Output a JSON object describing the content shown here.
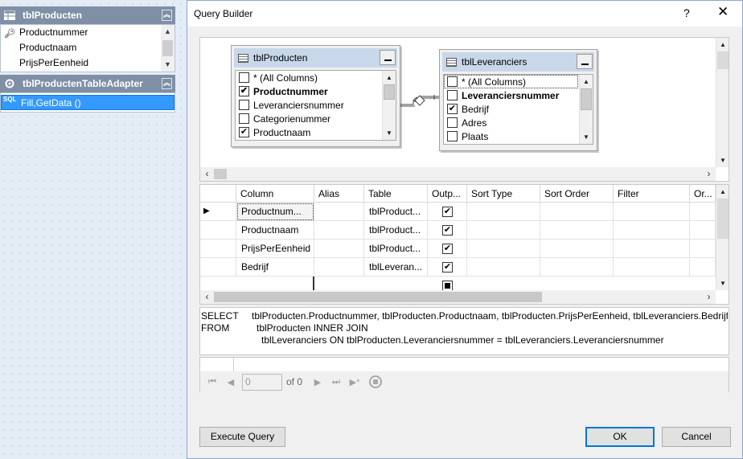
{
  "designer": {
    "table": {
      "title": "tblProducten",
      "collapse_icon": "double-chevron-up-icon",
      "rows": [
        "Productnummer",
        "Productnaam",
        "PrijsPerEenheid"
      ]
    },
    "adapter": {
      "title": "tblProductenTableAdapter",
      "collapse_icon": "double-chevron-up-icon",
      "method_icon_text": "SQL",
      "method": "Fill,GetData ()"
    }
  },
  "dialog": {
    "title": "Query Builder",
    "help": "?",
    "close": "✕"
  },
  "diagram": {
    "tables": [
      {
        "title": "tblProducten",
        "columns": [
          {
            "label": "* (All Columns)",
            "checked": false,
            "bold": false
          },
          {
            "label": "Productnummer",
            "checked": true,
            "bold": true
          },
          {
            "label": "Leveranciersnummer",
            "checked": false,
            "bold": false
          },
          {
            "label": "Categorienummer",
            "checked": false,
            "bold": false
          },
          {
            "label": "Productnaam",
            "checked": true,
            "bold": false
          }
        ]
      },
      {
        "title": "tblLeveranciers",
        "columns": [
          {
            "label": "* (All Columns)",
            "checked": false,
            "bold": false
          },
          {
            "label": "Leveranciersnummer",
            "checked": false,
            "bold": true
          },
          {
            "label": "Bedrijf",
            "checked": true,
            "bold": false
          },
          {
            "label": "Adres",
            "checked": false,
            "bold": false
          },
          {
            "label": "Plaats",
            "checked": false,
            "bold": false
          }
        ]
      }
    ]
  },
  "grid": {
    "headers": [
      "Column",
      "Alias",
      "Table",
      "Outp...",
      "Sort Type",
      "Sort Order",
      "Filter",
      "Or..."
    ],
    "rows": [
      {
        "column": "Productnum...",
        "alias": "",
        "table": "tblProduct...",
        "output": true
      },
      {
        "column": "Productnaam",
        "alias": "",
        "table": "tblProduct...",
        "output": true
      },
      {
        "column": "PrijsPerEenheid",
        "alias": "",
        "table": "tblProduct...",
        "output": true
      },
      {
        "column": "Bedrijf",
        "alias": "",
        "table": "tblLeveran...",
        "output": true
      }
    ]
  },
  "sql": {
    "kw_select": "SELECT",
    "select_list": "tblProducten.Productnummer, tblProducten.Productnaam, tblProducten.PrijsPerEenheid, tblLeveranciers.Bedrijf",
    "kw_from": "FROM",
    "from_line1": "tblProducten INNER JOIN",
    "from_line2": "tblLeveranciers ON tblProducten.Leveranciersnummer = tblLeveranciers.Leveranciersnummer"
  },
  "results": {
    "position": "0",
    "of_label": "of 0"
  },
  "buttons": {
    "execute": "Execute Query",
    "ok": "OK",
    "cancel": "Cancel"
  }
}
